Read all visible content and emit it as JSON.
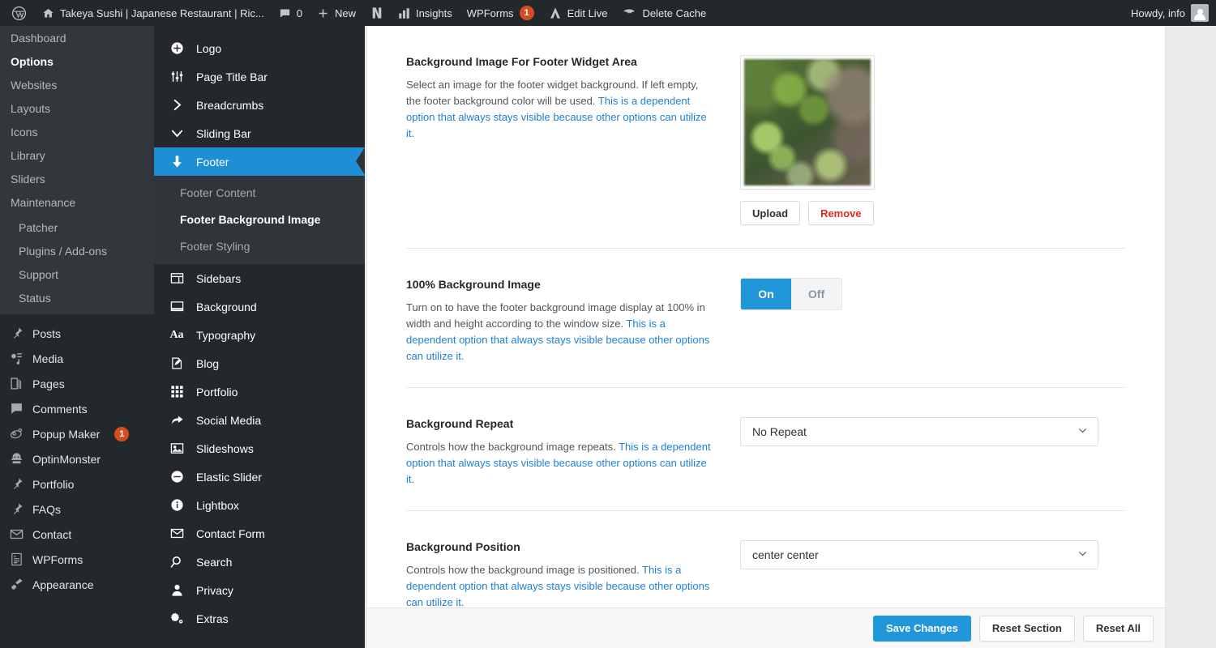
{
  "adminbar": {
    "site_title": "Takeya Sushi | Japanese Restaurant | Ric...",
    "comments_count": "0",
    "new_label": "New",
    "insights_label": "Insights",
    "wpforms_label": "WPForms",
    "wpforms_count": "1",
    "edit_live_label": "Edit Live",
    "delete_cache_label": "Delete Cache",
    "howdy": "Howdy, info"
  },
  "sidebar": {
    "theme_items": [
      {
        "label": "Dashboard",
        "current": false
      },
      {
        "label": "Options",
        "current": true
      },
      {
        "label": "Websites",
        "current": false
      },
      {
        "label": "Layouts",
        "current": false
      },
      {
        "label": "Icons",
        "current": false
      },
      {
        "label": "Library",
        "current": false
      },
      {
        "label": "Sliders",
        "current": false
      },
      {
        "label": "Maintenance",
        "current": false
      }
    ],
    "sub_items": [
      {
        "label": "Patcher"
      },
      {
        "label": "Plugins / Add-ons"
      },
      {
        "label": "Support"
      },
      {
        "label": "Status"
      }
    ],
    "wp_items": [
      {
        "label": "Posts",
        "icon": "pin-icon",
        "badge": ""
      },
      {
        "label": "Media",
        "icon": "media-icon",
        "badge": ""
      },
      {
        "label": "Pages",
        "icon": "pages-icon",
        "badge": ""
      },
      {
        "label": "Comments",
        "icon": "comment-icon",
        "badge": ""
      },
      {
        "label": "Popup Maker",
        "icon": "popup-maker-icon",
        "badge": "1"
      },
      {
        "label": "OptinMonster",
        "icon": "optinmonster-icon",
        "badge": ""
      },
      {
        "label": "Portfolio",
        "icon": "pin-icon",
        "badge": ""
      },
      {
        "label": "FAQs",
        "icon": "pin-icon",
        "badge": ""
      },
      {
        "label": "Contact",
        "icon": "envelope-icon",
        "badge": ""
      },
      {
        "label": "WPForms",
        "icon": "form-icon",
        "badge": ""
      },
      {
        "label": "Appearance",
        "icon": "brush-icon",
        "badge": ""
      }
    ]
  },
  "options_nav": {
    "items": [
      {
        "label": "Logo",
        "icon": "plus-circle-icon",
        "active": false
      },
      {
        "label": "Page Title Bar",
        "icon": "sliders-icon",
        "active": false
      },
      {
        "label": "Breadcrumbs",
        "icon": "chevron-right-icon",
        "active": false
      },
      {
        "label": "Sliding Bar",
        "icon": "chevron-down-icon",
        "active": false
      },
      {
        "label": "Footer",
        "icon": "arrow-down-icon",
        "active": true
      }
    ],
    "footer_subitems": [
      {
        "label": "Footer Content",
        "current": false
      },
      {
        "label": "Footer Background Image",
        "current": true
      },
      {
        "label": "Footer Styling",
        "current": false
      }
    ],
    "items_after": [
      {
        "label": "Sidebars",
        "icon": "sidebar-icon"
      },
      {
        "label": "Background",
        "icon": "background-icon"
      },
      {
        "label": "Typography",
        "icon": "typography-icon"
      },
      {
        "label": "Blog",
        "icon": "blog-icon"
      },
      {
        "label": "Portfolio",
        "icon": "grid-icon"
      },
      {
        "label": "Social Media",
        "icon": "share-icon"
      },
      {
        "label": "Slideshows",
        "icon": "image-icon"
      },
      {
        "label": "Elastic Slider",
        "icon": "minus-circle-icon"
      },
      {
        "label": "Lightbox",
        "icon": "info-circle-icon"
      },
      {
        "label": "Contact Form",
        "icon": "envelope-icon"
      },
      {
        "label": "Search",
        "icon": "search-icon"
      },
      {
        "label": "Privacy",
        "icon": "user-icon"
      },
      {
        "label": "Extras",
        "icon": "cogs-icon"
      }
    ]
  },
  "main": {
    "rows": [
      {
        "title": "Background Image For Footer Widget Area",
        "desc_plain": "Select an image for the footer widget background. If left empty, the footer background color will be used. ",
        "desc_link": "This is a dependent option that always stays visible because other options can utilize it.",
        "control": "image",
        "upload_label": "Upload",
        "remove_label": "Remove"
      },
      {
        "title": "100% Background Image",
        "desc_plain": "Turn on to have the footer background image display at 100% in width and height according to the window size. ",
        "desc_link": "This is a dependent option that always stays visible because other options can utilize it.",
        "control": "toggle",
        "on_label": "On",
        "off_label": "Off",
        "value": "On"
      },
      {
        "title": "Background Repeat",
        "desc_plain": "Controls how the background image repeats. ",
        "desc_link": "This is a dependent option that always stays visible because other options can utilize it.",
        "control": "select",
        "value": "No Repeat"
      },
      {
        "title": "Background Position",
        "desc_plain": "Controls how the background image is positioned. ",
        "desc_link": "This is a dependent option that always stays visible because other options can utilize it.",
        "control": "select",
        "value": "center center"
      }
    ]
  },
  "action_bar": {
    "save_label": "Save Changes",
    "reset_section_label": "Reset Section",
    "reset_all_label": "Reset All"
  },
  "colors": {
    "accent": "#1e8fd5",
    "primary_button": "#2196d9",
    "link": "#1e7fd4",
    "danger": "#e02b20",
    "admin_bar": "#23282d",
    "badge": "#d54e21"
  }
}
